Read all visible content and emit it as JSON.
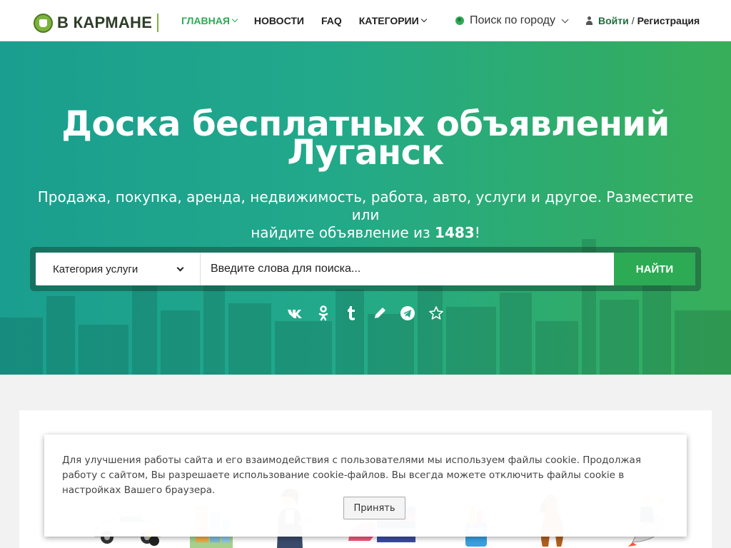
{
  "header": {
    "logo_text": "В КАРМАНЕ",
    "nav": [
      {
        "label": "Главная",
        "active": true,
        "has_dropdown": true
      },
      {
        "label": "Новости",
        "active": false,
        "has_dropdown": false
      },
      {
        "label": "FAQ",
        "active": false,
        "has_dropdown": false
      },
      {
        "label": "Категории",
        "active": false,
        "has_dropdown": true
      }
    ],
    "city_search": "Поиск по городу",
    "login": "Войти",
    "separator": "/",
    "register": "Регистрация"
  },
  "hero": {
    "title_line1": "Доска бесплатных объявлений",
    "title_line2": "Луганск",
    "subtitle_line1": "Продажа, покупка, аренда, недвижимость, работа, авто, услуги и другое. Разместите или",
    "subtitle_line2_prefix": "найдите объявление из",
    "ad_count": "1483",
    "subtitle_line2_suffix": "!"
  },
  "search": {
    "category": "Категория услуги",
    "placeholder": "Введите слова для поиска...",
    "button": "Найти"
  },
  "socials": [
    "vk-icon",
    "odnoklassniki-icon",
    "tumblr-icon",
    "pencil-icon",
    "telegram-icon",
    "star-icon"
  ],
  "cookie": {
    "text": "Для улучшения работы сайта и его взаимодействия с пользователями мы используем файлы cookie. Продолжая работу с сайтом, Вы разрешаете использование cookie-файлов. Вы всегда можете отключить файлы cookie в настройках Вашего браузера.",
    "button": "Принять"
  },
  "categories": [
    "car-icon",
    "buildings-icon",
    "operator-icon",
    "clothes-icon",
    "cleaning-icon",
    "dog-icon",
    "businessman-rocket-icon"
  ],
  "colors": {
    "accent": "#2daa54",
    "hero_left": "#1a9e8f",
    "hero_right": "#37ae59",
    "login": "#1f6e3a"
  }
}
